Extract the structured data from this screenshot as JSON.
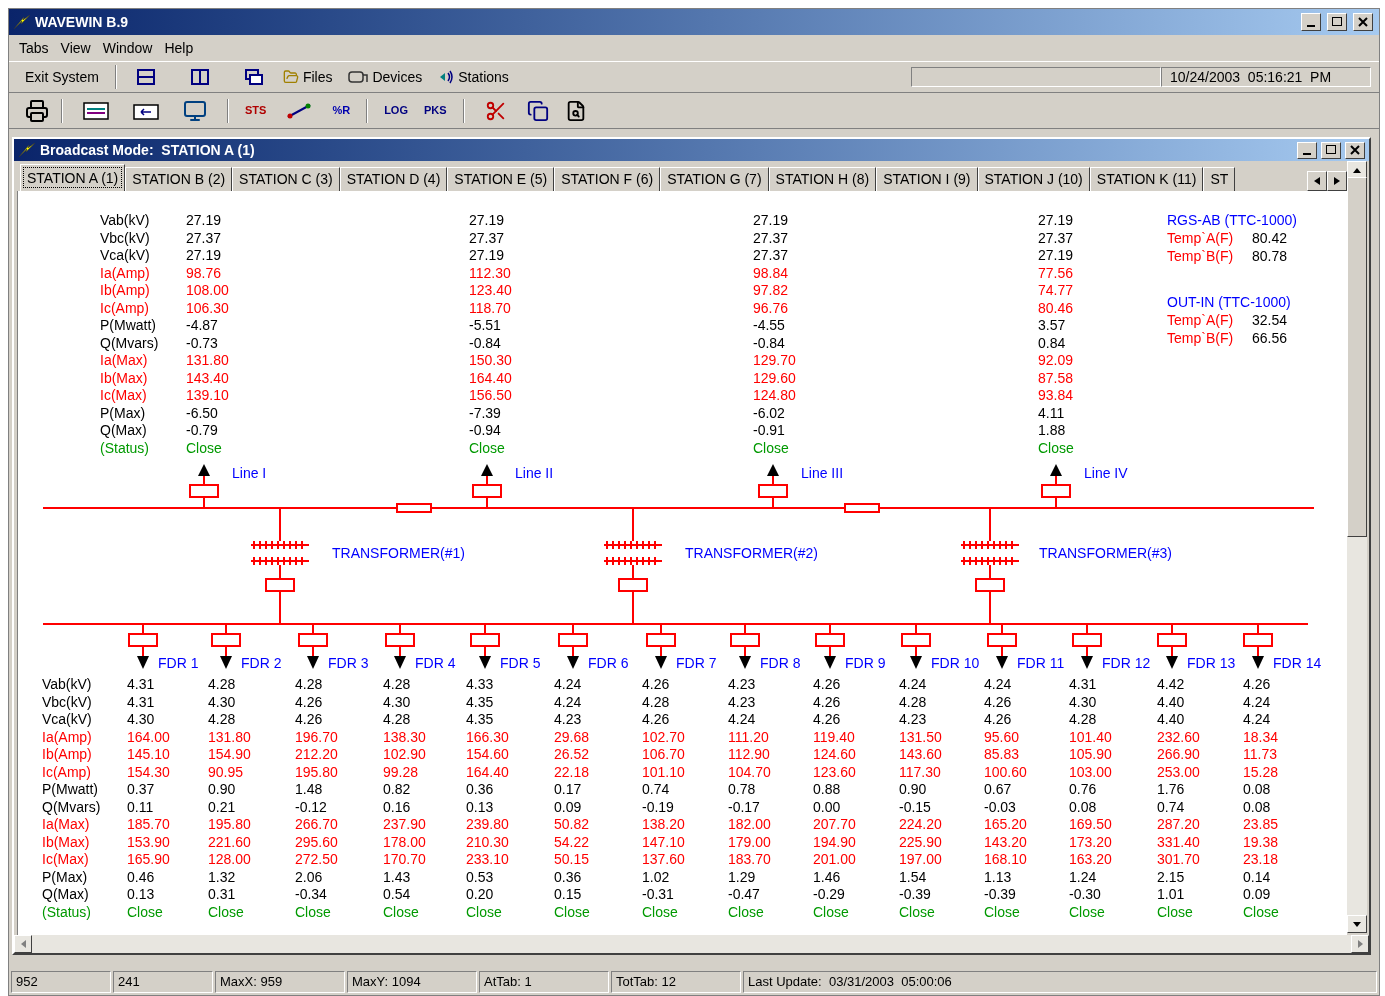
{
  "window": {
    "title": "WAVEWIN B.9"
  },
  "menu": [
    "Tabs",
    "View",
    "Window",
    "Help"
  ],
  "toolbar": {
    "exit": "Exit System",
    "files": "Files",
    "devices": "Devices",
    "stations": "Stations",
    "datetime": "10/24/2003  05:16:21  PM"
  },
  "toolbar_glyphs": [
    "STS",
    "%R",
    "LOG",
    "PKS"
  ],
  "child_window": {
    "title": "Broadcast Mode:  STATION A (1)"
  },
  "tabs": [
    {
      "label": "STATION A (1)",
      "selected": true
    },
    {
      "label": "STATION B (2)",
      "selected": false
    },
    {
      "label": "STATION C (3)",
      "selected": false
    },
    {
      "label": "STATION D (4)",
      "selected": false
    },
    {
      "label": "STATION E (5)",
      "selected": false
    },
    {
      "label": "STATION F (6)",
      "selected": false
    },
    {
      "label": "STATION G (7)",
      "selected": false
    },
    {
      "label": "STATION H (8)",
      "selected": false
    },
    {
      "label": "STATION I (9)",
      "selected": false
    },
    {
      "label": "STATION J (10)",
      "selected": false
    },
    {
      "label": "STATION K (11)",
      "selected": false
    },
    {
      "label": "ST",
      "selected": false
    }
  ],
  "rows": [
    {
      "label": "Vab(kV)",
      "kind": "voltage"
    },
    {
      "label": "Vbc(kV)",
      "kind": "voltage"
    },
    {
      "label": "Vca(kV)",
      "kind": "voltage"
    },
    {
      "label": "Ia(Amp)",
      "kind": "current"
    },
    {
      "label": "Ib(Amp)",
      "kind": "current"
    },
    {
      "label": "Ic(Amp)",
      "kind": "current"
    },
    {
      "label": "P(Mwatt)",
      "kind": "power"
    },
    {
      "label": "Q(Mvars)",
      "kind": "power"
    },
    {
      "label": "Ia(Max)",
      "kind": "current"
    },
    {
      "label": "Ib(Max)",
      "kind": "current"
    },
    {
      "label": "Ic(Max)",
      "kind": "current"
    },
    {
      "label": "P(Max)",
      "kind": "power"
    },
    {
      "label": "Q(Max)",
      "kind": "power"
    },
    {
      "label": "(Status)",
      "kind": "status"
    }
  ],
  "feeder_rows": [
    {
      "label": "Vab(kV)",
      "kind": "voltage"
    },
    {
      "label": "Vbc(kV)",
      "kind": "voltage"
    },
    {
      "label": "Vca(kV)",
      "kind": "voltage"
    },
    {
      "label": "Ia(Amp)",
      "kind": "current"
    },
    {
      "label": "Ib(Amp)",
      "kind": "current"
    },
    {
      "label": "Ic(Amp)",
      "kind": "current"
    },
    {
      "label": "P(Mwatt)",
      "kind": "power"
    },
    {
      "label": "Q(Mvars)",
      "kind": "power"
    },
    {
      "label": "Ia(Max)",
      "kind": "current"
    },
    {
      "label": "Ib(Max)",
      "kind": "current"
    },
    {
      "label": "Ic(Max)",
      "kind": "current"
    },
    {
      "label": "P(Max)",
      "kind": "power"
    },
    {
      "label": "Q(Max)",
      "kind": "power"
    },
    {
      "label": "(Status)",
      "kind": "status"
    }
  ],
  "lines": [
    {
      "name": "Line I",
      "values": [
        "27.19",
        "27.37",
        "27.19",
        "98.76",
        "108.00",
        "106.30",
        "-4.87",
        "-0.73",
        "131.80",
        "143.40",
        "139.10",
        "-6.50",
        "-0.79",
        "Close"
      ]
    },
    {
      "name": "Line II",
      "values": [
        "27.19",
        "27.37",
        "27.19",
        "112.30",
        "123.40",
        "118.70",
        "-5.51",
        "-0.84",
        "150.30",
        "164.40",
        "156.50",
        "-7.39",
        "-0.94",
        "Close"
      ]
    },
    {
      "name": "Line III",
      "values": [
        "27.19",
        "27.37",
        "27.37",
        "98.84",
        "97.82",
        "96.76",
        "-4.55",
        "-0.84",
        "129.70",
        "129.60",
        "124.80",
        "-6.02",
        "-0.91",
        "Close"
      ]
    },
    {
      "name": "Line IV",
      "values": [
        "27.19",
        "27.37",
        "27.19",
        "77.56",
        "74.77",
        "80.46",
        "3.57",
        "0.84",
        "92.09",
        "87.58",
        "93.84",
        "4.11",
        "1.88",
        "Close"
      ]
    }
  ],
  "sensors": [
    {
      "title": "RGS-AB (TTC-1000)",
      "readings": [
        {
          "label": "Temp`A(F)",
          "value": "80.42"
        },
        {
          "label": "Temp`B(F)",
          "value": "80.78"
        }
      ]
    },
    {
      "title": "OUT-IN (TTC-1000)",
      "readings": [
        {
          "label": "Temp`A(F)",
          "value": "32.54"
        },
        {
          "label": "Temp`B(F)",
          "value": "66.56"
        }
      ]
    }
  ],
  "transformers": [
    "TRANSFORMER(#1)",
    "TRANSFORMER(#2)",
    "TRANSFORMER(#3)"
  ],
  "feeders": [
    {
      "name": "FDR 1",
      "values": [
        "4.31",
        "4.31",
        "4.30",
        "164.00",
        "145.10",
        "154.30",
        "0.37",
        "0.11",
        "185.70",
        "153.90",
        "165.90",
        "0.46",
        "0.13",
        "Close"
      ]
    },
    {
      "name": "FDR 2",
      "values": [
        "4.28",
        "4.30",
        "4.28",
        "131.80",
        "154.90",
        "90.95",
        "0.90",
        "0.21",
        "195.80",
        "221.60",
        "128.00",
        "1.32",
        "0.31",
        "Close"
      ]
    },
    {
      "name": "FDR 3",
      "values": [
        "4.28",
        "4.26",
        "4.26",
        "196.70",
        "212.20",
        "195.80",
        "1.48",
        "-0.12",
        "266.70",
        "295.60",
        "272.50",
        "2.06",
        "-0.34",
        "Close"
      ]
    },
    {
      "name": "FDR 4",
      "values": [
        "4.28",
        "4.30",
        "4.28",
        "138.30",
        "102.90",
        "99.28",
        "0.82",
        "0.16",
        "237.90",
        "178.00",
        "170.70",
        "1.43",
        "0.54",
        "Close"
      ]
    },
    {
      "name": "FDR 5",
      "values": [
        "4.33",
        "4.35",
        "4.35",
        "166.30",
        "154.60",
        "164.40",
        "0.36",
        "0.13",
        "239.80",
        "210.30",
        "233.10",
        "0.53",
        "0.20",
        "Close"
      ]
    },
    {
      "name": "FDR 6",
      "values": [
        "4.24",
        "4.24",
        "4.23",
        "29.68",
        "26.52",
        "22.18",
        "0.17",
        "0.09",
        "50.82",
        "54.22",
        "50.15",
        "0.36",
        "0.15",
        "Close"
      ]
    },
    {
      "name": "FDR 7",
      "values": [
        "4.26",
        "4.28",
        "4.26",
        "102.70",
        "106.70",
        "101.10",
        "0.74",
        "-0.19",
        "138.20",
        "147.10",
        "137.60",
        "1.02",
        "-0.31",
        "Close"
      ]
    },
    {
      "name": "FDR 8",
      "values": [
        "4.23",
        "4.23",
        "4.24",
        "111.20",
        "112.90",
        "104.70",
        "0.78",
        "-0.17",
        "182.00",
        "179.00",
        "183.70",
        "1.29",
        "-0.47",
        "Close"
      ]
    },
    {
      "name": "FDR 9",
      "values": [
        "4.26",
        "4.26",
        "4.26",
        "119.40",
        "124.60",
        "123.60",
        "0.88",
        "0.00",
        "207.70",
        "194.90",
        "201.00",
        "1.46",
        "-0.29",
        "Close"
      ]
    },
    {
      "name": "FDR 10",
      "values": [
        "4.24",
        "4.28",
        "4.23",
        "131.50",
        "143.60",
        "117.30",
        "0.90",
        "-0.15",
        "224.20",
        "225.90",
        "197.00",
        "1.54",
        "-0.39",
        "Close"
      ]
    },
    {
      "name": "FDR 11",
      "values": [
        "4.24",
        "4.26",
        "4.26",
        "95.60",
        "85.83",
        "100.60",
        "0.67",
        "-0.03",
        "165.20",
        "143.20",
        "168.10",
        "1.13",
        "-0.39",
        "Close"
      ]
    },
    {
      "name": "FDR 12",
      "values": [
        "4.31",
        "4.30",
        "4.28",
        "101.40",
        "105.90",
        "103.00",
        "0.76",
        "0.08",
        "169.50",
        "173.20",
        "163.20",
        "1.24",
        "-0.30",
        "Close"
      ]
    },
    {
      "name": "FDR 13",
      "values": [
        "4.42",
        "4.40",
        "4.40",
        "232.60",
        "266.90",
        "253.00",
        "1.76",
        "0.74",
        "287.20",
        "331.40",
        "301.70",
        "2.15",
        "1.01",
        "Close"
      ]
    },
    {
      "name": "FDR 14",
      "values": [
        "4.26",
        "4.24",
        "4.24",
        "18.34",
        "11.73",
        "15.28",
        "0.08",
        "0.08",
        "23.85",
        "19.38",
        "23.18",
        "0.14",
        "0.09",
        "Close"
      ]
    }
  ],
  "status_bar": [
    "952",
    "241",
    "MaxX: 959",
    "MaxY: 1094",
    "AtTab: 1",
    "TotTab: 12",
    "Last Update:  03/31/2003  05:00:06"
  ]
}
